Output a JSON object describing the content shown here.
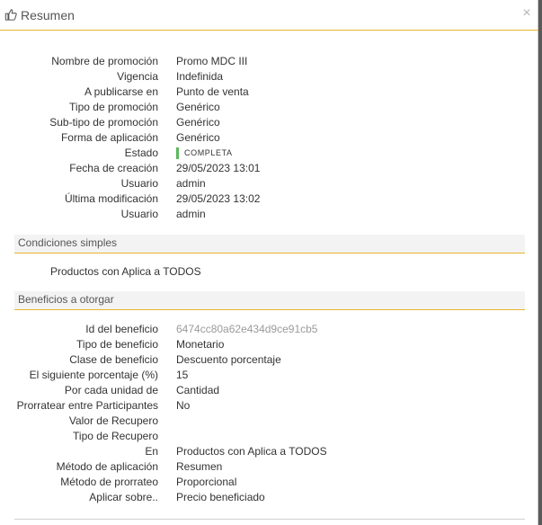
{
  "modal": {
    "title": "Resumen",
    "title_icon": "thumbs-up-icon",
    "close_icon": "close-icon",
    "close_glyph": "×"
  },
  "summary": [
    {
      "label": "Nombre de promoción",
      "value": "Promo MDC III"
    },
    {
      "label": "Vigencia",
      "value": "Indefinida"
    },
    {
      "label": "A publicarse en",
      "value": "Punto de venta"
    },
    {
      "label": "Tipo de promoción",
      "value": "Genérico"
    },
    {
      "label": "Sub-tipo de promoción",
      "value": "Genérico"
    },
    {
      "label": "Forma de aplicación",
      "value": "Genérico"
    },
    {
      "label": "Estado",
      "value": "COMPLETA"
    },
    {
      "label": "Fecha de creación",
      "value": "29/05/2023 13:01"
    },
    {
      "label": "Usuario",
      "value": "admin"
    },
    {
      "label": "Última modificación",
      "value": "29/05/2023 13:02"
    },
    {
      "label": "Usuario",
      "value": "admin"
    }
  ],
  "conditions": {
    "heading": "Condiciones simples",
    "items": [
      "Productos con Aplica a TODOS"
    ]
  },
  "benefits": {
    "heading": "Beneficios a otorgar",
    "rows": [
      {
        "label": "Id del beneficio",
        "value": "6474cc80a62e434d9ce91cb5"
      },
      {
        "label": "Tipo de beneficio",
        "value": "Monetario"
      },
      {
        "label": "Clase de beneficio",
        "value": "Descuento porcentaje"
      },
      {
        "label": "El siguiente porcentaje (%)",
        "value": "15"
      },
      {
        "label": "Por cada unidad de",
        "value": "Cantidad"
      },
      {
        "label": "Prorratear entre Participantes",
        "value": "No"
      },
      {
        "label": "Valor de Recupero",
        "value": ""
      },
      {
        "label": "Tipo de Recupero",
        "value": ""
      },
      {
        "label": "En",
        "value": "Productos con Aplica a TODOS"
      },
      {
        "label": "Método de aplicación",
        "value": "Resumen"
      },
      {
        "label": "Método de prorrateo",
        "value": "Proporcional"
      },
      {
        "label": "Aplicar sobre..",
        "value": "Precio beneficiado"
      }
    ]
  },
  "colors": {
    "accent": "#e7b52c",
    "status_complete": "#5cb85c"
  }
}
